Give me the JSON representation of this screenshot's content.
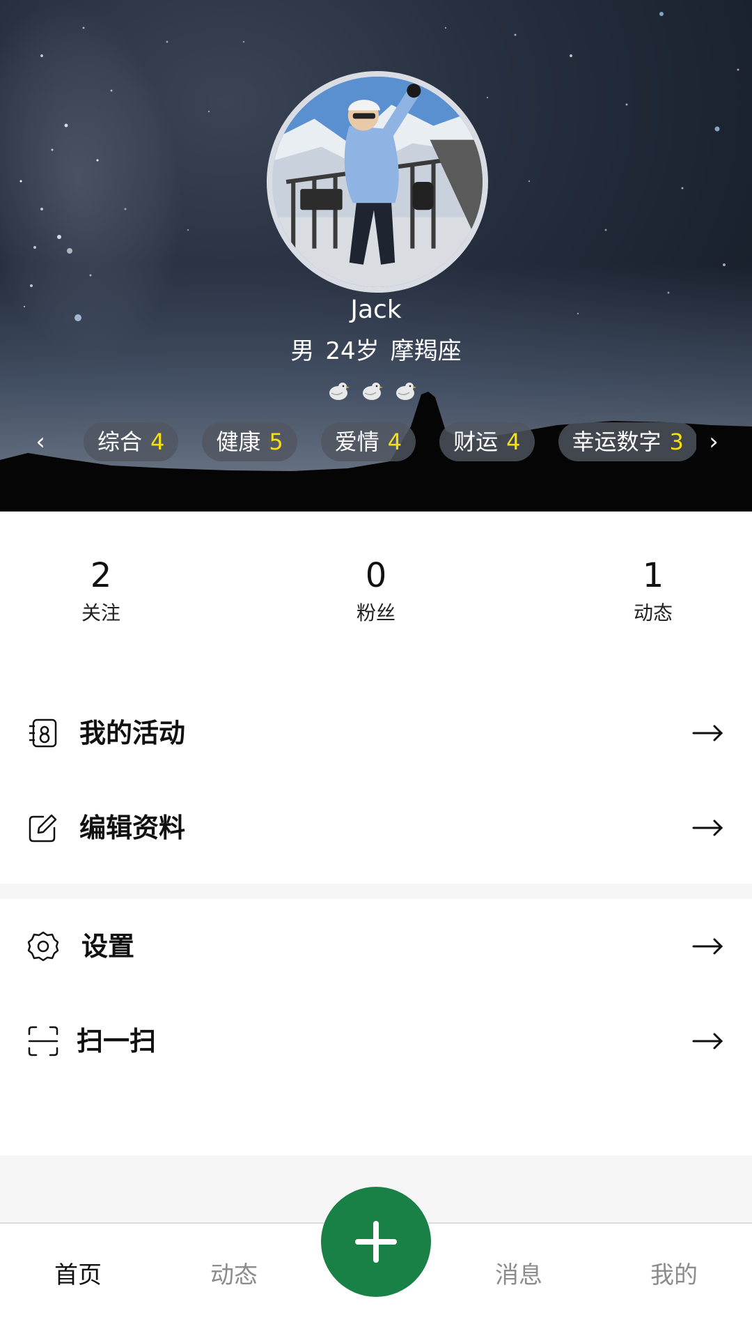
{
  "profile": {
    "name": "Jack",
    "gender": "男",
    "age": "24岁",
    "zodiac": "摩羯座",
    "bird_icons": [
      "bird-icon",
      "bird-icon",
      "bird-icon"
    ]
  },
  "fortune_tags": [
    {
      "label": "综合",
      "value": "4"
    },
    {
      "label": "健康",
      "value": "5"
    },
    {
      "label": "爱情",
      "value": "4"
    },
    {
      "label": "财运",
      "value": "4"
    },
    {
      "label": "幸运数字",
      "value": "3"
    }
  ],
  "stats": [
    {
      "value": "2",
      "label": "关注"
    },
    {
      "value": "0",
      "label": "粉丝"
    },
    {
      "value": "1",
      "label": "动态"
    }
  ],
  "menu": {
    "group1": [
      {
        "label": "我的活动",
        "icon": "activity-icon"
      },
      {
        "label": "编辑资料",
        "icon": "edit-icon"
      }
    ],
    "group2": [
      {
        "label": "设置",
        "icon": "gear-icon"
      },
      {
        "label": "扫一扫",
        "icon": "scan-icon"
      }
    ]
  },
  "bottom_nav": {
    "home": "首页",
    "feed": "动态",
    "messages": "消息",
    "mine": "我的"
  },
  "colors": {
    "accent_green": "#1a8146",
    "tag_number_yellow": "#f5e10f"
  }
}
